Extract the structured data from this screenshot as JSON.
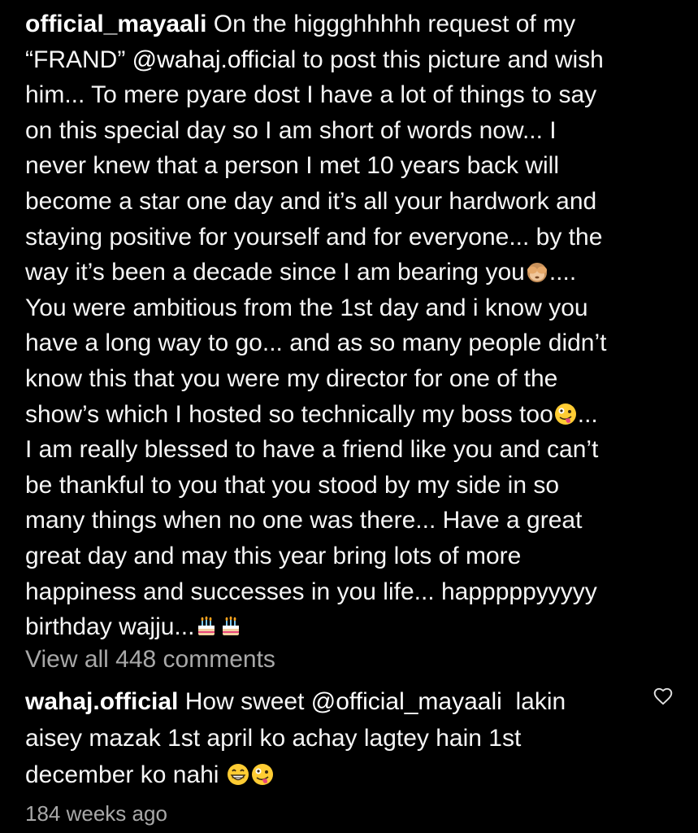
{
  "post": {
    "author": "official_mayaali",
    "caption_lines": [
      {
        "pre": "On the higgghhhhh request of my"
      },
      {
        "pre": "“FRAND” ",
        "mention": "@wahaj.official",
        "post": " to post this picture and wish"
      },
      {
        "pre": "him... To mere pyare dost I have a lot of things to say"
      },
      {
        "pre": "on this special day so I am short of words now... I"
      },
      {
        "pre": "never knew that a person I met 10 years back will"
      },
      {
        "pre": "become a star one day and it’s all your hardwork and"
      },
      {
        "pre": "staying positive for yourself and for everyone... by the"
      },
      {
        "pre": "way it’s been a decade since I am bearing you",
        "after_emoji": "...."
      },
      {
        "pre": "You were ambitious from the 1st day and i know you"
      },
      {
        "pre": "have a long way to go... and as so many people didn’t"
      },
      {
        "pre": "know this that you were my director for one of the"
      },
      {
        "pre": "show’s which I hosted so technically my boss too",
        "after_emoji": "..."
      },
      {
        "pre": "I am really blessed to have a friend like you and can’t"
      },
      {
        "pre": "be thankful to you that you stood by my side in so"
      },
      {
        "pre": "many things when no one was there... Have a great"
      },
      {
        "pre": "great day and may this year bring lots of more"
      },
      {
        "pre": "happiness and successes in you life... happpppyyyyy"
      },
      {
        "pre": "birthday wajju..."
      }
    ],
    "emojis": {
      "see_no_evil": "see-no-evil-monkey-icon",
      "zany": "zany-face-icon",
      "cake": "birthday-cake-icon",
      "grin": "grinning-face-icon"
    }
  },
  "view_all_comments": "View all 448 comments",
  "comment": {
    "author": "wahaj.official",
    "line1_pre": "How sweet ",
    "line1_mention": "@official_mayaali",
    "line1_post": "  lakin",
    "line2": "aisey mazak 1st april ko achay lagtey hain 1st",
    "line3": "december ko nahi ",
    "like_icon": "heart-outline-icon"
  },
  "timestamp": "184 weeks ago",
  "colors": {
    "background": "#000000",
    "text": "#f5f5f5",
    "secondary_text": "#a8a8a8"
  }
}
